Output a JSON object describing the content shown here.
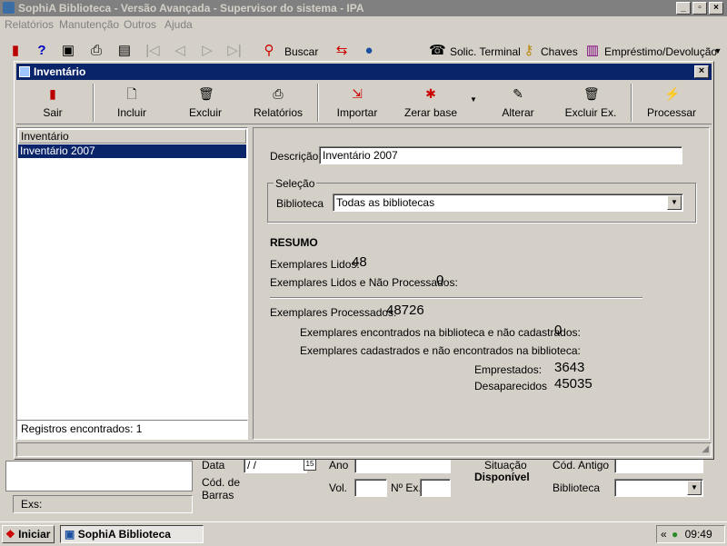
{
  "app": {
    "title": "SophiA Biblioteca - Versão Avançada - Supervisor do sistema - IPA",
    "menu": [
      "Relatórios",
      "Manutenção",
      "Outros",
      "Ajuda"
    ],
    "toolbar": {
      "buscar": "Buscar",
      "solic_terminal": "Solic. Terminal",
      "chaves": "Chaves",
      "emprestimo": "Empréstimo/Devolução"
    }
  },
  "background": {
    "exs_label": "Exs:",
    "data_label": "Data",
    "data_value": "/ /",
    "ano_label": "Ano",
    "cod_barras_label": "Cód. de\nBarras",
    "vol_label": "Vol.",
    "nex_label": "Nº Ex.",
    "situacao_label": "Situação",
    "situacao_value": "Disponível",
    "cod_antigo_label": "Cód. Antigo",
    "biblioteca_label": "Biblioteca"
  },
  "dialog": {
    "title": "Inventário",
    "toolbar": [
      "Sair",
      "Incluir",
      "Excluir",
      "Relatórios",
      "Importar",
      "Zerar base",
      "Alterar",
      "Excluir Ex.",
      "Processar"
    ],
    "list_header": "Inventário",
    "list_items": [
      "Inventário 2007"
    ],
    "list_status": "Registros encontrados: 1",
    "descricao_label": "Descrição",
    "descricao_value": "Inventário 2007",
    "selecao_label": "Seleção",
    "biblioteca_label": "Biblioteca",
    "biblioteca_value": "Todas as bibliotecas",
    "resumo": {
      "title": "RESUMO",
      "lidos_label": "Exemplares Lidos:",
      "lidos_value": "48",
      "lidos_nao_proc_label": "Exemplares Lidos e Não Processados:",
      "lidos_nao_proc_value": "0",
      "processados_label": "Exemplares Processados:",
      "processados_value": "48726",
      "encontrados_nao_cad_label": "Exemplares encontrados na biblioteca e não cadastrados:",
      "encontrados_nao_cad_value": "0",
      "cad_nao_encontrados_label": "Exemplares cadastrados e não encontrados na biblioteca:",
      "emprestados_label": "Emprestados:",
      "emprestados_value": "3643",
      "desaparecidos_label": "Desaparecidos",
      "desaparecidos_value": "45035"
    }
  },
  "taskbar": {
    "start": "Iniciar",
    "task": "SophiA Biblioteca",
    "time": "09:49",
    "chevron": "«"
  }
}
